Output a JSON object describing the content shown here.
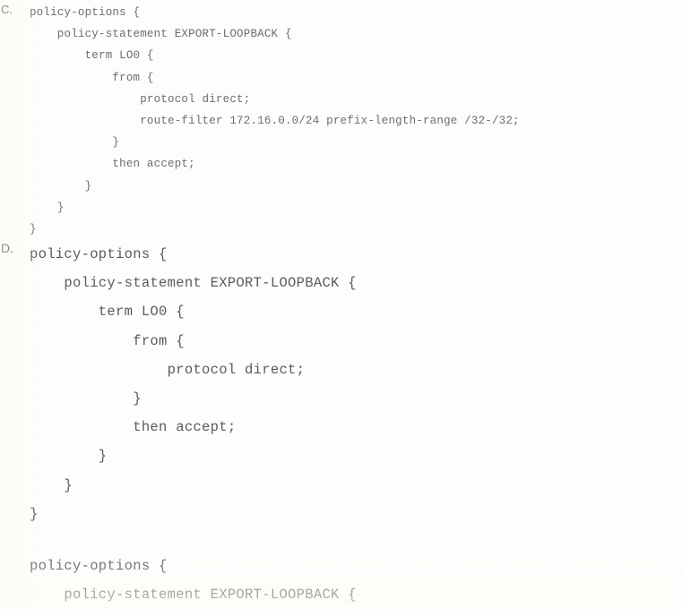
{
  "page": {
    "background_color": "#fdfdfb",
    "text_color_faded": "#6d6d6d",
    "text_color_dark": "#5a5a5a"
  },
  "options": [
    {
      "letter": "C.",
      "name": "option-c",
      "lines": [
        "policy-options {",
        "    policy-statement EXPORT-LOOPBACK {",
        "        term LO0 {",
        "            from {",
        "                protocol direct;",
        "                route-filter 172.16.0.0/24 prefix-length-range /32-/32;",
        "            }",
        "            then accept;",
        "        }",
        "    }",
        "}"
      ]
    },
    {
      "letter": "D.",
      "name": "option-d",
      "lines": [
        "policy-options {",
        "    policy-statement EXPORT-LOOPBACK {",
        "        term LO0 {",
        "            from {",
        "                protocol direct;",
        "            }",
        "            then accept;",
        "        }",
        "    }",
        "}"
      ]
    }
  ],
  "trailing_block": {
    "name": "trailing-partial-config",
    "lines": [
      "policy-options {",
      "    policy-statement EXPORT-LOOPBACK {"
    ]
  }
}
